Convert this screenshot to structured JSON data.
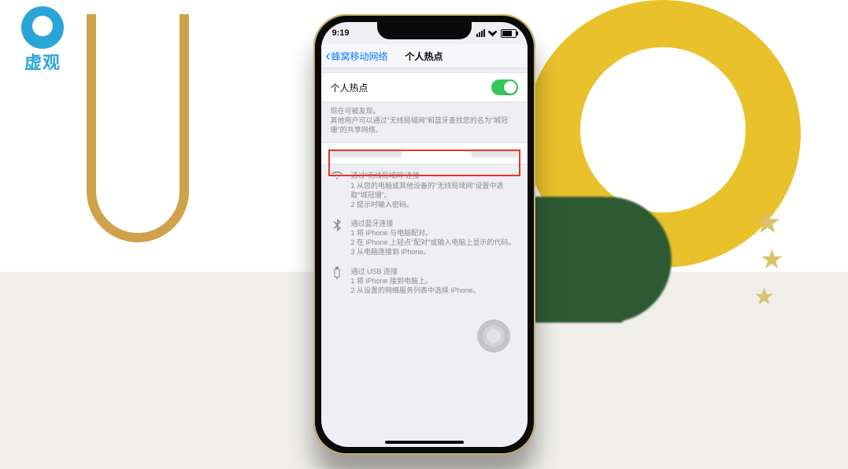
{
  "watermark": {
    "text": "虚观"
  },
  "status": {
    "time": "9:19"
  },
  "nav": {
    "back": "蜂窝移动网络",
    "title": "个人热点"
  },
  "toggle": {
    "label": "个人热点",
    "on": true
  },
  "discover": {
    "line1": "现在可被发现。",
    "line2": "其他用户可以通过\"无线局域网\"和蓝牙查找您的名为\"城冠珊\"的共享网络。"
  },
  "password_row": {
    "label": "无线局域网 密码",
    "value": "••••••••"
  },
  "wifi": {
    "title": "通过\"无线局域网\"连接",
    "step1": "1 从您的电脑或其他设备的\"无线局域网\"设置中选取\"城冠珊\"。",
    "step2": "2 提示时输入密码。"
  },
  "bt": {
    "title": "通过蓝牙连接",
    "step1": "1 将 iPhone 与电脑配对。",
    "step2": "2 在 iPhone 上轻点\"配对\"或输入电脑上显示的代码。",
    "step3": "3 从电脑连接到 iPhone。"
  },
  "usb": {
    "title": "通过 USB 连接",
    "step1": "1 将 iPhone 接到电脑上。",
    "step2": "2 从设置的网络服务列表中选择 iPhone。"
  }
}
